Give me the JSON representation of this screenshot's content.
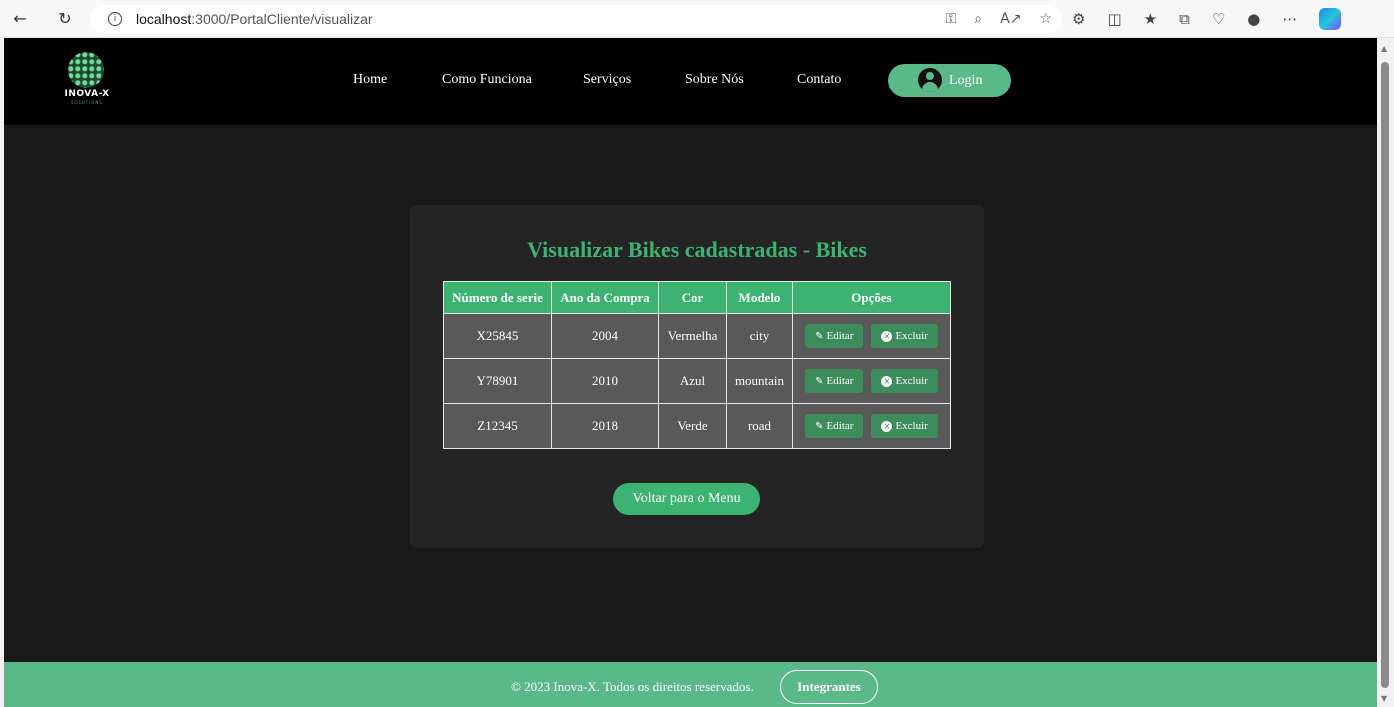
{
  "browser": {
    "url_host": "localhost",
    "url_path": ":3000/PortalCliente/visualizar",
    "icons": [
      "back-icon",
      "refresh-icon",
      "info-icon",
      "key-icon",
      "zoom-icon",
      "read-aloud-icon",
      "star-icon",
      "extensions-icon",
      "split-screen-icon",
      "favorites-icon",
      "collections-icon",
      "heartbeat-icon",
      "profile-icon",
      "more-icon",
      "copilot-icon"
    ]
  },
  "header": {
    "logo_name": "INOVA-X",
    "logo_sub": "SOLUTIONS",
    "menu": [
      "Home",
      "Como Funciona",
      "Serviços",
      "Sobre Nós",
      "Contato"
    ],
    "login_label": "Login"
  },
  "main": {
    "title": "Visualizar Bikes cadastradas - Bikes",
    "columns": [
      "Número de serie",
      "Ano da Compra",
      "Cor",
      "Modelo",
      "Opções"
    ],
    "rows": [
      {
        "serie": "X25845",
        "ano": "2004",
        "cor": "Vermelha",
        "modelo": "city"
      },
      {
        "serie": "Y78901",
        "ano": "2010",
        "cor": "Azul",
        "modelo": "mountain"
      },
      {
        "serie": "Z12345",
        "ano": "2018",
        "cor": "Verde",
        "modelo": "road"
      }
    ],
    "edit_label": "Editar",
    "delete_label": "Excluir",
    "back_label": "Voltar para o Menu"
  },
  "footer": {
    "copyright": "© 2023 Inova-X. Todos os direitos reservados.",
    "team_label": "Integrantes"
  },
  "colors": {
    "accent": "#3cb371",
    "footer": "#5bb889",
    "background": "#191919",
    "card": "#242424",
    "cell": "#595959"
  }
}
